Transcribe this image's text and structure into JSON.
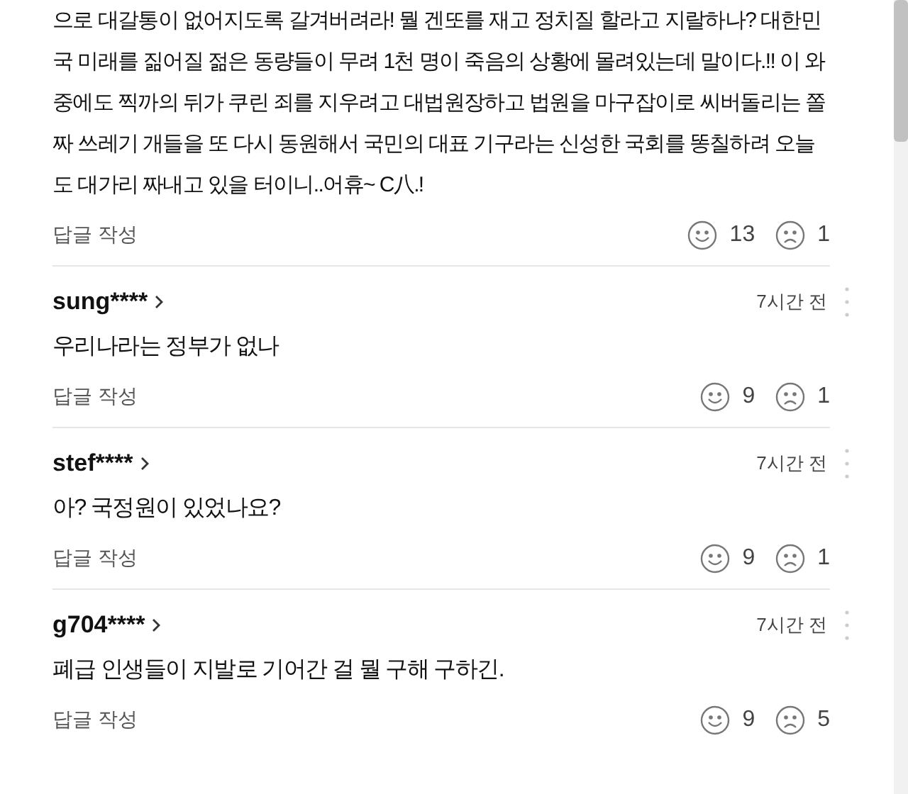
{
  "comments": [
    {
      "body": "으로 대갈통이 없어지도록 갈겨버려라! 뭘 겐또를 재고 정치질 할라고 지랄하나? 대한민국 미래를 짊어질 젊은 동량들이 무려 1천 명이 죽음의 상황에 몰려있는데 말이다.!! 이 와중에도 찍까의 뒤가 쿠린 죄를 지우려고 대법원장하고 법원을 마구잡이로 씨버돌리는 쫄짜 쓰레기 개들을 또 다시 동원해서 국민의 대표 기구라는 신성한 국회를 똥칠하려 오늘도 대가리 짜내고 있을 터이니..어휴~ C八.!",
      "reply": "답글 작성",
      "likes": "13",
      "dislikes": "1"
    },
    {
      "user": "sung****",
      "time": "7시간 전",
      "body": "우리나라는 정부가 없나",
      "reply": "답글 작성",
      "likes": "9",
      "dislikes": "1"
    },
    {
      "user": "stef****",
      "time": "7시간 전",
      "body": "아? 국정원이 있었나요?",
      "reply": "답글 작성",
      "likes": "9",
      "dislikes": "1"
    },
    {
      "user": "g704****",
      "time": "7시간 전",
      "body": "폐급 인생들이 지발로 기어간 걸 뭘 구해 구하긴.",
      "reply": "답글 작성",
      "likes": "9",
      "dislikes": "5"
    }
  ]
}
